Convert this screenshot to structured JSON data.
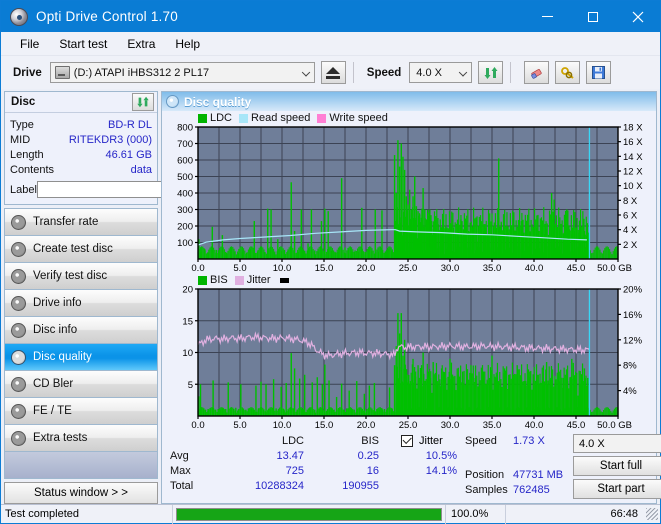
{
  "window": {
    "title": "Opti Drive Control 1.70",
    "icon": "disc-icon",
    "minimize": "minimize-icon",
    "maximize": "maximize-icon",
    "close": "close-icon"
  },
  "menu": [
    "File",
    "Start test",
    "Extra",
    "Help"
  ],
  "toolbar": {
    "drive_label": "Drive",
    "drive_value": "(D:)  ATAPI iHBS312  2 PL17",
    "eject_icon": "eject-icon",
    "speed_label": "Speed",
    "speed_value": "4.0 X",
    "refresh_icon": "refresh-icon",
    "eraser_icon": "eraser-icon",
    "keys_icon": "keys-icon",
    "save_icon": "save-icon"
  },
  "disc": {
    "title": "Disc",
    "refresh_icon": "refresh-icon",
    "rows": [
      {
        "key": "Type",
        "value": "BD-R DL"
      },
      {
        "key": "MID",
        "value": "RITEKDR3 (000)"
      },
      {
        "key": "Length",
        "value": "46.61 GB"
      },
      {
        "key": "Contents",
        "value": "data"
      }
    ],
    "label_key": "Label",
    "label_value": "",
    "label_placeholder": "",
    "label_button_icon": "cd-icon"
  },
  "nav": {
    "items": [
      {
        "label": "Transfer rate",
        "active": false
      },
      {
        "label": "Create test disc",
        "active": false
      },
      {
        "label": "Verify test disc",
        "active": false
      },
      {
        "label": "Drive info",
        "active": false
      },
      {
        "label": "Disc info",
        "active": false
      },
      {
        "label": "Disc quality",
        "active": true
      },
      {
        "label": "CD Bler",
        "active": false
      },
      {
        "label": "FE / TE",
        "active": false
      },
      {
        "label": "Extra tests",
        "active": false
      }
    ],
    "status_window": "Status window > >"
  },
  "panel": {
    "title": "Disc quality",
    "icon": "disc-quality-icon"
  },
  "stats": {
    "columns": [
      "",
      "LDC",
      "BIS",
      "Jitter"
    ],
    "jitter_checked": true,
    "rows": [
      {
        "label": "Avg",
        "ldc": "13.47",
        "bis": "0.25",
        "jitter": "10.5%"
      },
      {
        "label": "Max",
        "ldc": "725",
        "bis": "16",
        "jitter": "14.1%"
      },
      {
        "label": "Total",
        "ldc": "10288324",
        "bis": "190955",
        "jitter": ""
      }
    ]
  },
  "readout": {
    "speed_key": "Speed",
    "speed_value": "1.73 X",
    "position_key": "Position",
    "position_value": "47731 MB",
    "samples_key": "Samples",
    "samples_value": "762485",
    "speed_select": "4.0 X",
    "start_full": "Start full",
    "start_part": "Start part"
  },
  "statusbar": {
    "message": "Test completed",
    "percent_text": "100.0%",
    "percent_value": 100,
    "elapsed": "66:48"
  },
  "colors": {
    "accent": "#0a7cd4",
    "plot_bg": "#6f7e99",
    "ldc_green": "#00c000",
    "read_speed": "#a8e6f8",
    "write_speed": "#ff7fd4",
    "jitter_pink": "#e0b0e0",
    "value_blue": "#2626c8",
    "progress_green": "#16a516"
  },
  "chart_data": [
    {
      "type": "line",
      "name": "ldc-chart",
      "title": "",
      "xlabel": "GB",
      "ylabel": "LDC",
      "xlim": [
        0,
        50
      ],
      "ylim": [
        0,
        800
      ],
      "xticks": [
        "0.0",
        "5.0",
        "10.0",
        "15.0",
        "20.0",
        "25.0",
        "30.0",
        "35.0",
        "40.0",
        "45.0",
        "50.0 GB"
      ],
      "yticks": [
        "100",
        "200",
        "300",
        "400",
        "500",
        "600",
        "700",
        "800"
      ],
      "y2label": "Speed",
      "y2lim": [
        0,
        18
      ],
      "y2ticks": [
        "2 X",
        "4 X",
        "6 X",
        "8 X",
        "10 X",
        "12 X",
        "14 X",
        "16 X",
        "18 X"
      ],
      "grid": true,
      "legend": [
        {
          "label": "LDC",
          "color": "#00b400"
        },
        {
          "label": "Read speed",
          "color": "#a8e6f8"
        },
        {
          "label": "Write speed",
          "color": "#ff7fd4"
        }
      ],
      "marker_x": 46.6,
      "series": [
        {
          "name": "LDC",
          "kind": "impulse",
          "x": [
            0.1,
            0.4,
            0.8,
            1.2,
            1.7,
            2.2,
            2.5,
            2.9,
            3.4,
            3.9,
            4.3,
            4.8,
            5.3,
            5.8,
            6.2,
            6.7,
            7.1,
            7.5,
            7.9,
            8.3,
            8.7,
            9.1,
            9.5,
            9.9,
            10.3,
            10.7,
            11.1,
            11.5,
            11.9,
            12.3,
            12.7,
            13.1,
            13.5,
            13.9,
            14.3,
            14.7,
            15.1,
            15.5,
            15.9,
            16.3,
            16.7,
            17.1,
            17.5,
            17.9,
            18.3,
            18.7,
            19.1,
            19.5,
            19.9,
            20.3,
            20.7,
            21.1,
            21.5,
            21.9,
            22.3,
            22.7,
            23.1,
            23.4,
            23.6,
            23.8,
            24.0,
            24.2,
            24.4,
            24.6,
            24.8,
            25.0,
            25.2,
            25.4,
            25.6,
            25.8,
            26.0,
            26.2,
            26.4,
            26.6,
            26.8,
            27.0,
            27.2,
            27.4,
            27.6,
            27.8,
            28.0,
            28.3,
            28.6,
            28.9,
            29.2,
            29.5,
            29.8,
            30.1,
            30.4,
            30.7,
            31.0,
            31.3,
            31.6,
            31.9,
            32.2,
            32.5,
            32.8,
            33.1,
            33.4,
            33.7,
            34.0,
            34.3,
            34.6,
            34.9,
            35.2,
            35.5,
            35.8,
            36.1,
            36.4,
            36.7,
            37.0,
            37.3,
            37.6,
            37.9,
            38.2,
            38.5,
            38.8,
            39.1,
            39.4,
            39.7,
            40.0,
            40.3,
            40.6,
            40.9,
            41.2,
            41.5,
            41.8,
            42.1,
            42.4,
            42.7,
            43.0,
            43.3,
            43.6,
            43.9,
            44.2,
            44.5,
            44.8,
            45.1,
            45.4,
            45.7,
            46.0,
            46.3,
            46.5
          ],
          "y": [
            120,
            45,
            60,
            40,
            195,
            55,
            40,
            145,
            38,
            70,
            44,
            36,
            40,
            38,
            60,
            230,
            46,
            44,
            42,
            305,
            300,
            40,
            120,
            48,
            55,
            50,
            465,
            170,
            42,
            300,
            50,
            95,
            300,
            52,
            44,
            230,
            305,
            290,
            50,
            44,
            42,
            490,
            70,
            58,
            44,
            52,
            44,
            310,
            42,
            60,
            48,
            300,
            44,
            295,
            46,
            58,
            50,
            630,
            400,
            720,
            560,
            700,
            620,
            540,
            380,
            330,
            420,
            300,
            380,
            500,
            320,
            290,
            270,
            250,
            430,
            300,
            240,
            260,
            300,
            230,
            180,
            260,
            210,
            190,
            240,
            200,
            170,
            210,
            190,
            160,
            200,
            240,
            180,
            230,
            170,
            190,
            210,
            150,
            200,
            180,
            170,
            190,
            220,
            160,
            200,
            180,
            610,
            220,
            170,
            200,
            160,
            190,
            210,
            170,
            150,
            230,
            160,
            180,
            200,
            140,
            160,
            190,
            170,
            200,
            150,
            180,
            140,
            400,
            360,
            170,
            190,
            140,
            160,
            300,
            180,
            150,
            170,
            140,
            160,
            130,
            170,
            140,
            160
          ],
          "color": "#00c000"
        },
        {
          "name": "Read speed",
          "kind": "line",
          "x": [
            0.0,
            1.0,
            3.0,
            5.0,
            8.0,
            11.0,
            14.0,
            17.0,
            20.0,
            23.0,
            23.5,
            24.0,
            26.0,
            29.0,
            32.0,
            35.0,
            38.0,
            41.0,
            44.0,
            46.3
          ],
          "y": [
            1.9,
            2.3,
            2.6,
            2.8,
            3.0,
            3.2,
            3.5,
            3.7,
            3.9,
            4.0,
            4.0,
            3.8,
            3.7,
            3.6,
            3.4,
            3.3,
            3.1,
            2.9,
            2.7,
            2.6
          ],
          "color": "#a8e6f8",
          "axis": "y2"
        }
      ]
    },
    {
      "type": "line",
      "name": "bis-jitter-chart",
      "title": "",
      "xlabel": "GB",
      "ylabel": "BIS",
      "xlim": [
        0,
        50
      ],
      "ylim": [
        0,
        20
      ],
      "xticks": [
        "0.0",
        "5.0",
        "10.0",
        "15.0",
        "20.0",
        "25.0",
        "30.0",
        "35.0",
        "40.0",
        "45.0",
        "50.0 GB"
      ],
      "yticks": [
        "5",
        "10",
        "15",
        "20"
      ],
      "y2label": "Jitter",
      "y2lim": [
        0,
        20
      ],
      "y2ticks": [
        "4%",
        "8%",
        "12%",
        "16%",
        "20%"
      ],
      "grid": true,
      "legend": [
        {
          "label": "BIS",
          "color": "#00b400"
        },
        {
          "label": "Jitter",
          "color": "#e0b0e0"
        }
      ],
      "marker_x": 46.6,
      "series": [
        {
          "name": "BIS",
          "kind": "impulse",
          "x": [
            0.1,
            0.3,
            0.6,
            0.9,
            1.2,
            1.5,
            1.8,
            2.1,
            2.4,
            2.7,
            3.0,
            3.3,
            3.6,
            3.9,
            4.2,
            4.5,
            4.8,
            5.1,
            5.4,
            5.7,
            6.0,
            6.3,
            6.6,
            6.9,
            7.2,
            7.5,
            7.8,
            8.1,
            8.4,
            8.7,
            9.0,
            9.3,
            9.6,
            9.9,
            10.2,
            10.5,
            10.8,
            11.1,
            11.4,
            11.5,
            11.8,
            12.1,
            12.4,
            12.7,
            13.0,
            13.3,
            13.6,
            13.9,
            14.2,
            14.5,
            14.8,
            15.1,
            15.4,
            15.6,
            15.9,
            16.2,
            16.5,
            16.8,
            17.1,
            17.4,
            17.7,
            18.0,
            18.3,
            18.6,
            18.9,
            19.2,
            19.5,
            19.8,
            20.1,
            20.4,
            20.7,
            21.0,
            21.3,
            21.6,
            21.9,
            22.2,
            22.5,
            22.8,
            23.1,
            23.4,
            23.6,
            23.8,
            24.0,
            24.2,
            24.4,
            24.6,
            24.8,
            25.0,
            25.3,
            25.6,
            25.9,
            26.2,
            26.5,
            26.8,
            27.1,
            27.4,
            27.7,
            28.0,
            28.5,
            29.0,
            29.5,
            30.0,
            30.5,
            31.0,
            31.5,
            32.0,
            32.5,
            33.0,
            33.5,
            34.0,
            34.5,
            35.0,
            35.5,
            36.0,
            36.5,
            37.0,
            37.5,
            38.0,
            38.5,
            39.0,
            39.5,
            40.0,
            40.5,
            41.0,
            41.5,
            42.0,
            42.5,
            43.0,
            43.5,
            44.0,
            44.5,
            45.0,
            45.5,
            46.0,
            46.4
          ],
          "y": [
            3.1,
            5.0,
            1.2,
            1.0,
            1.1,
            1.2,
            5.6,
            1.0,
            1.1,
            1.0,
            1.2,
            1.1,
            5.3,
            1.0,
            1.1,
            1.3,
            1.0,
            5.0,
            1.1,
            1.0,
            1.2,
            1.1,
            1.0,
            4.8,
            1.2,
            5.4,
            1.0,
            5.0,
            1.1,
            1.0,
            5.8,
            1.2,
            1.0,
            4.6,
            1.1,
            5.2,
            1.0,
            9.9,
            1.2,
            7.5,
            1.0,
            5.9,
            1.1,
            6.5,
            1.0,
            1.2,
            5.3,
            1.0,
            6.1,
            1.1,
            5.0,
            8.1,
            1.0,
            5.6,
            1.2,
            1.0,
            3.0,
            1.1,
            5.1,
            1.0,
            1.2,
            4.0,
            1.1,
            1.0,
            5.5,
            1.2,
            1.0,
            3.5,
            1.1,
            4.8,
            1.0,
            5.2,
            1.1,
            1.0,
            1.2,
            1.1,
            1.0,
            4.5,
            1.2,
            8.0,
            11.0,
            16.2,
            13.0,
            16.2,
            9.5,
            12.0,
            7.0,
            6.5,
            5.5,
            9.0,
            7.0,
            8.0,
            6.0,
            10.0,
            5.5,
            7.0,
            6.0,
            8.5,
            5.0,
            7.5,
            6.0,
            9.0,
            5.0,
            6.5,
            7.0,
            5.5,
            8.0,
            6.0,
            5.0,
            7.0,
            5.5,
            9.5,
            6.0,
            5.0,
            7.5,
            6.5,
            5.0,
            8.0,
            6.0,
            5.5,
            7.0,
            5.0,
            6.5,
            5.5,
            8.5,
            6.0,
            5.0,
            7.0,
            6.0,
            5.5,
            9.0,
            6.5,
            5.0,
            7.5,
            6.0
          ],
          "color": "#00c000"
        },
        {
          "name": "Jitter",
          "kind": "noisy-line",
          "x": [
            0.0,
            1.0,
            2.0,
            3.0,
            4.0,
            5.0,
            6.0,
            7.0,
            8.0,
            9.0,
            10.0,
            11.0,
            12.0,
            13.0,
            13.5,
            14.0,
            14.5,
            15.0,
            15.5,
            16.0,
            17.0,
            18.0,
            19.0,
            20.0,
            21.0,
            22.0,
            23.0,
            23.4,
            23.8,
            24.5,
            26.0,
            28.0,
            30.0,
            32.0,
            34.0,
            36.0,
            38.0,
            40.0,
            42.0,
            44.0,
            46.0,
            46.4
          ],
          "y": [
            11.2,
            12.0,
            12.2,
            12.1,
            12.3,
            12.2,
            12.4,
            12.4,
            12.3,
            12.2,
            12.3,
            12.2,
            12.0,
            11.6,
            11.2,
            10.5,
            10.0,
            9.6,
            9.5,
            9.6,
            9.8,
            9.9,
            10.0,
            9.9,
            9.9,
            9.8,
            9.7,
            9.5,
            11.0,
            10.8,
            10.9,
            10.9,
            11.0,
            10.9,
            11.0,
            10.9,
            10.8,
            10.7,
            10.6,
            10.5,
            10.4,
            10.4
          ],
          "color": "#e0b0e0",
          "axis": "y2",
          "noise": 0.7
        }
      ]
    }
  ]
}
